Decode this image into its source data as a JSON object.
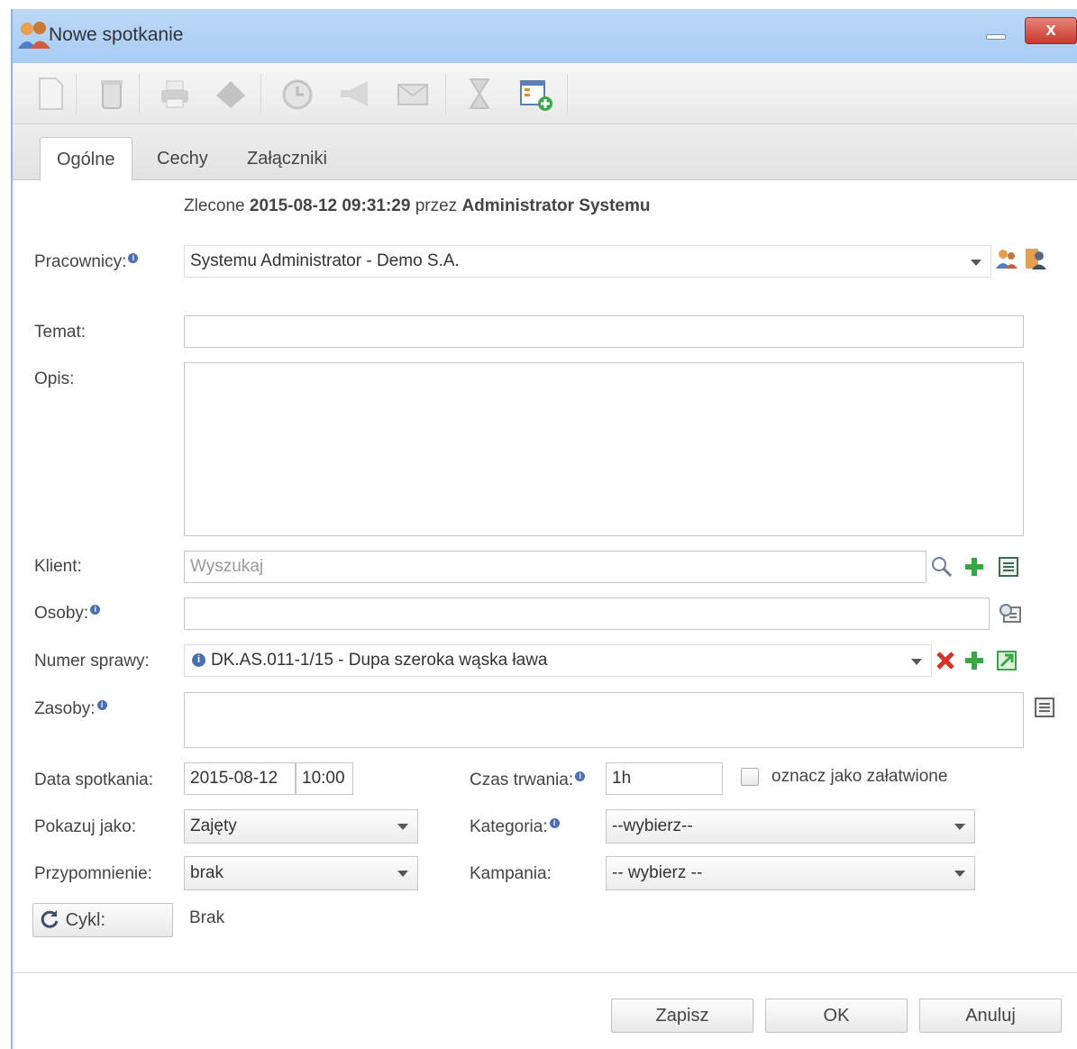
{
  "window": {
    "title": "Nowe spotkanie",
    "close_label": "x"
  },
  "toolbar": {
    "buttons": [
      "new-document-icon",
      "trash-icon",
      "print-icon",
      "export-icon",
      "alarm-clock-icon",
      "megaphone-icon",
      "mail-icon",
      "hourglass-icon",
      "add-window-icon"
    ]
  },
  "tabs": [
    {
      "label": "Ogólne",
      "active": true
    },
    {
      "label": "Cechy"
    },
    {
      "label": "Załączniki"
    }
  ],
  "header": {
    "prefix": "Zlecone",
    "date": "2015-08-12 09:31:29",
    "by": "przez",
    "author": "Administrator Systemu"
  },
  "form": {
    "pracownicy_label": "Pracownicy:",
    "pracownicy_value": "Systemu Administrator - Demo S.A.",
    "temat_label": "Temat:",
    "temat_value": "",
    "opis_label": "Opis:",
    "opis_value": "",
    "klient_label": "Klient:",
    "klient_placeholder": "Wyszukaj",
    "osoby_label": "Osoby:",
    "osoby_value": "",
    "numer_label": "Numer sprawy:",
    "numer_value": "DK.AS.011-1/15 - Dupa szeroka wąska ława",
    "zasoby_label": "Zasoby:",
    "zasoby_value": "",
    "data_label": "Data spotkania:",
    "data_date": "2015-08-12",
    "data_time": "10:00",
    "czas_label": "Czas trwania:",
    "czas_value": "1h",
    "zalatwione_label": "oznacz jako załatwione",
    "pokazuj_label": "Pokazuj jako:",
    "pokazuj_value": "Zajęty",
    "kategoria_label": "Kategoria:",
    "kategoria_value": "--wybierz--",
    "przypomnienie_label": "Przypomnienie:",
    "przypomnienie_value": "brak",
    "kampania_label": "Kampania:",
    "kampania_value": "-- wybierz --",
    "cykl_label": "Cykl:",
    "cykl_value": "Brak"
  },
  "footer": {
    "save_label": "Zapisz",
    "ok_label": "OK",
    "cancel_label": "Anuluj"
  }
}
